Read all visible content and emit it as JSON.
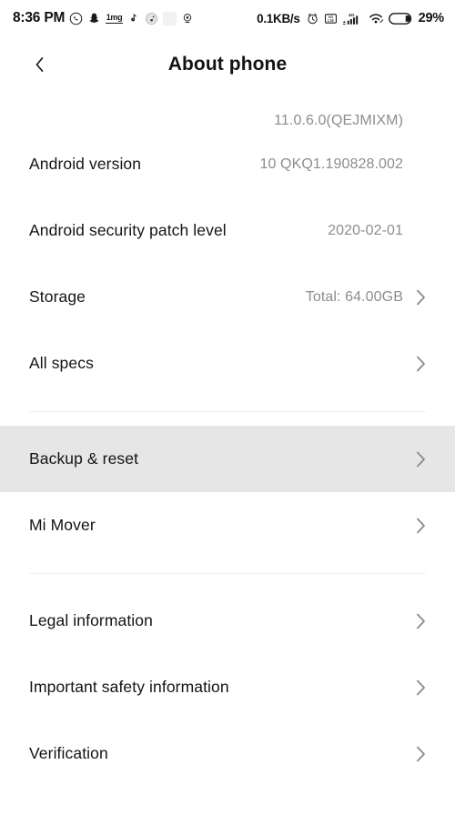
{
  "status_bar": {
    "time": "8:36 PM",
    "left_icons": [
      {
        "name": "whatsapp-icon",
        "label": "WhatsApp"
      },
      {
        "name": "snapchat-icon",
        "label": "Snapchat"
      },
      {
        "name": "onemg-icon",
        "label": "1mg"
      },
      {
        "name": "tiktok-icon",
        "label": "TikTok"
      },
      {
        "name": "music-disc-icon",
        "label": "Music"
      },
      {
        "name": "microsoft-apps-icon",
        "label": "Microsoft"
      },
      {
        "name": "location-pin-icon",
        "label": "Location"
      }
    ],
    "network_speed": "0.1KB/s",
    "right_icons": [
      {
        "name": "alarm-clock-icon",
        "label": "Alarm"
      },
      {
        "name": "volte-icon",
        "label": "VoLTE"
      },
      {
        "name": "signal-4g-icon",
        "label": "4G signal"
      },
      {
        "name": "wifi-icon",
        "label": "Wi-Fi"
      },
      {
        "name": "battery-icon",
        "label": "Battery"
      }
    ],
    "signal_label": "4G",
    "volte_label": "VoLTE",
    "battery_percent": "29%"
  },
  "header": {
    "back_icon": "chevron-left-icon",
    "title": "About phone"
  },
  "list": {
    "rows": [
      {
        "name": "miui-version-row",
        "label": "",
        "value": "11.0.6.0(QEJMIXM)",
        "chevron": false,
        "clipped": true,
        "highlighted": false
      },
      {
        "name": "android-version-row",
        "label": "Android version",
        "value": "10 QKQ1.190828.002",
        "chevron": false,
        "clipped": false,
        "highlighted": false
      },
      {
        "name": "android-security-patch-level-row",
        "label": "Android security patch level",
        "value": "2020-02-01",
        "chevron": false,
        "clipped": false,
        "highlighted": false
      },
      {
        "name": "storage-row",
        "label": "Storage",
        "value": "Total: 64.00GB",
        "chevron": true,
        "clipped": false,
        "highlighted": false
      },
      {
        "name": "all-specs-row",
        "label": "All specs",
        "value": "",
        "chevron": true,
        "clipped": false,
        "highlighted": false
      },
      {
        "name": "divider-1",
        "divider": true
      },
      {
        "name": "backup-and-reset-row",
        "label": "Backup & reset",
        "value": "",
        "chevron": true,
        "clipped": false,
        "highlighted": true
      },
      {
        "name": "mi-mover-row",
        "label": "Mi Mover",
        "value": "",
        "chevron": true,
        "clipped": false,
        "highlighted": false
      },
      {
        "name": "divider-2",
        "divider": true
      },
      {
        "name": "legal-information-row",
        "label": "Legal information",
        "value": "",
        "chevron": true,
        "clipped": false,
        "highlighted": false
      },
      {
        "name": "important-safety-information-row",
        "label": "Important safety information",
        "value": "",
        "chevron": true,
        "clipped": false,
        "highlighted": false
      },
      {
        "name": "verification-row",
        "label": "Verification",
        "value": "",
        "chevron": true,
        "clipped": false,
        "highlighted": false
      }
    ]
  },
  "colors": {
    "background": "#ffffff",
    "highlight": "#e6e6e6",
    "label_text": "#141414",
    "value_text": "#8d8d8d",
    "divider": "#f0f0f0",
    "chevron": "#8d8d8d"
  }
}
